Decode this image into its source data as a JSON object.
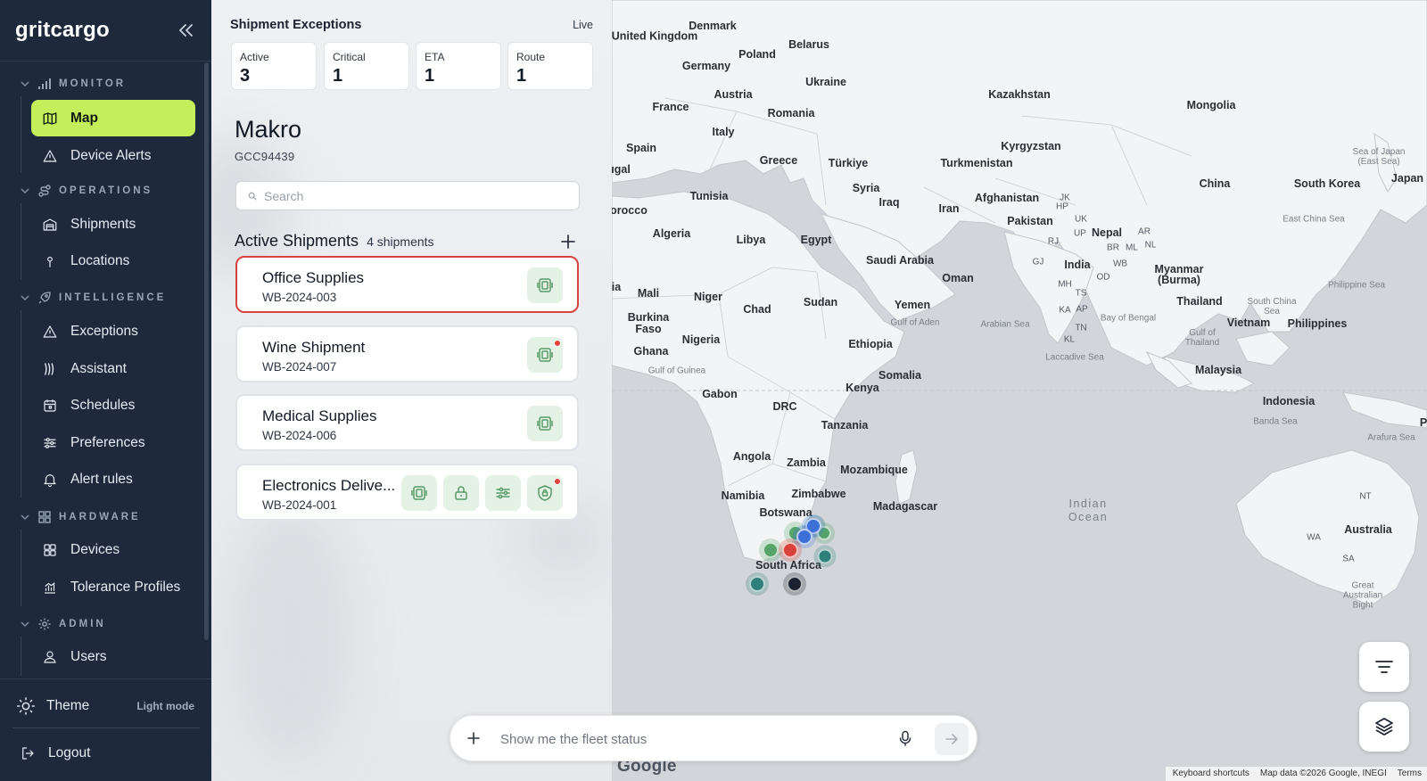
{
  "app": {
    "brand": "gritcargo"
  },
  "sidebar": {
    "sections": {
      "monitor": "MONITOR",
      "operations": "OPERATIONS",
      "intelligence": "INTELLIGENCE",
      "hardware": "HARDWARE",
      "admin": "ADMIN"
    },
    "items": {
      "map": "Map",
      "device_alerts": "Device Alerts",
      "shipments": "Shipments",
      "locations": "Locations",
      "exceptions": "Exceptions",
      "assistant": "Assistant",
      "schedules": "Schedules",
      "preferences": "Preferences",
      "alert_rules": "Alert rules",
      "devices": "Devices",
      "tolerance_profiles": "Tolerance Profiles",
      "users": "Users"
    },
    "active_item": "map",
    "theme_label": "Theme",
    "theme_mode": "Light mode",
    "logout_label": "Logout",
    "accent_color": "#c5ef5a",
    "background_color": "#1e2a3c"
  },
  "exceptions": {
    "title": "Shipment Exceptions",
    "live_label": "Live",
    "stats": [
      {
        "label": "Active",
        "value": "3"
      },
      {
        "label": "Critical",
        "value": "1"
      },
      {
        "label": "ETA",
        "value": "1"
      },
      {
        "label": "Route",
        "value": "1"
      }
    ]
  },
  "company": {
    "name": "Makro",
    "code": "GCC94439"
  },
  "search": {
    "placeholder": "Search"
  },
  "active_shipments": {
    "title": "Active Shipments",
    "count_label": "4 shipments",
    "items": [
      {
        "name": "Office Supplies",
        "id": "WB-2024-003",
        "selected": true,
        "icons": [
          "device-icon"
        ],
        "alert_dot": false
      },
      {
        "name": "Wine Shipment",
        "id": "WB-2024-007",
        "selected": false,
        "icons": [
          "device-icon"
        ],
        "alert_dot": true
      },
      {
        "name": "Medical Supplies",
        "id": "WB-2024-006",
        "selected": false,
        "icons": [
          "device-icon"
        ],
        "alert_dot": false
      },
      {
        "name": "Electronics Delive...",
        "id": "WB-2024-001",
        "selected": false,
        "icons": [
          "device-icon",
          "lock-icon",
          "sliders-icon",
          "shield-icon"
        ],
        "alert_dot": true
      }
    ],
    "selected_border_color": "#d6453f",
    "icon_bg_color": "#e3f2e5"
  },
  "map": {
    "labels": {
      "united_kingdom": "United Kingdom",
      "denmark": "Denmark",
      "belarus": "Belarus",
      "poland": "Poland",
      "germany": "Germany",
      "ukraine": "Ukraine",
      "kazakhstan": "Kazakhstan",
      "mongolia": "Mongolia",
      "austria": "Austria",
      "france": "France",
      "romania": "Romania",
      "italy": "Italy",
      "kyrgyzstan": "Kyrgyzstan",
      "sea_of_japan": "Sea of Japan (East Sea)",
      "japan": "Japan",
      "spain": "Spain",
      "greece": "Greece",
      "turkiye": "Türkiye",
      "turkmenistan": "Turkmenistan",
      "china": "China",
      "south_korea": "South Korea",
      "portugal": "ugal",
      "syria": "Syria",
      "tunisia": "Tunisia",
      "iraq": "Iraq",
      "afghanistan": "Afghanistan",
      "morocco": "orocco",
      "iran": "Iran",
      "pakistan": "Pakistan",
      "jk": "JK",
      "hp": "HP",
      "uk_state": "UK",
      "up": "UP",
      "nepal": "Nepal",
      "east_china_sea": "East China Sea",
      "algeria": "Algeria",
      "libya": "Libya",
      "egypt": "Egypt",
      "rj": "RJ",
      "br": "BR",
      "ml": "ML",
      "nl": "NL",
      "ar": "AR",
      "saudi_arabia": "Saudi Arabia",
      "gj": "GJ",
      "india": "India",
      "wb": "WB",
      "myanmar": "Myanmar (Burma)",
      "oman": "Oman",
      "od": "OD",
      "mh": "MH",
      "mali": "Mali",
      "niger": "Niger",
      "philippine_sea": "Philippine Sea",
      "mauritania": "ia",
      "sudan": "Sudan",
      "ts": "TS",
      "thailand": "Thailand",
      "chad": "Chad",
      "yemen": "Yemen",
      "ka": "KA",
      "ap": "AP",
      "south_china_sea": "South China Sea",
      "burkina_faso": "Burkina Faso",
      "gulf_of_aden": "Gulf of Aden",
      "arabian_sea": "Arabian Sea",
      "bay_of_bengal": "Bay of Bengal",
      "vietnam": "Vietnam",
      "philippines": "Philippines",
      "tn": "TN",
      "nigeria": "Nigeria",
      "ethiopia": "Ethiopia",
      "kl": "KL",
      "gulf_of_thailand": "Gulf of Thailand",
      "ghana": "Ghana",
      "laccadive_sea": "Laccadive Sea",
      "gulf_of_guinea": "Gulf of Guinea",
      "somalia": "Somalia",
      "malaysia": "Malaysia",
      "kenya": "Kenya",
      "gabon": "Gabon",
      "indonesia": "Indonesia",
      "drc": "DRC",
      "banda_sea": "Banda Sea",
      "tanzania": "Tanzania",
      "arafura_sea": "Arafura Sea",
      "p_edge": "P",
      "angola": "Angola",
      "zambia": "Zambia",
      "mozambique": "Mozambique",
      "namibia": "Namibia",
      "zimbabwe": "Zimbabwe",
      "nt": "NT",
      "madagascar": "Madagascar",
      "indian_ocean": "Indian Ocean",
      "botswana": "Botswana",
      "australia": "Australia",
      "wa": "WA",
      "sa": "SA",
      "south_africa": "South Africa",
      "great_australian_bight": "Great Australian Bight"
    },
    "marker_colors": {
      "green": "#56a46c",
      "teal": "#2f7f7a",
      "blue": "#3c70d6",
      "red": "#d9423b",
      "dark": "#1c2331"
    },
    "google_logo": "Google",
    "attribution": {
      "shortcuts": "Keyboard shortcuts",
      "data": "Map data ©2026 Google, INEGI",
      "terms": "Terms"
    }
  },
  "chat": {
    "placeholder": "Show me the fleet status"
  }
}
